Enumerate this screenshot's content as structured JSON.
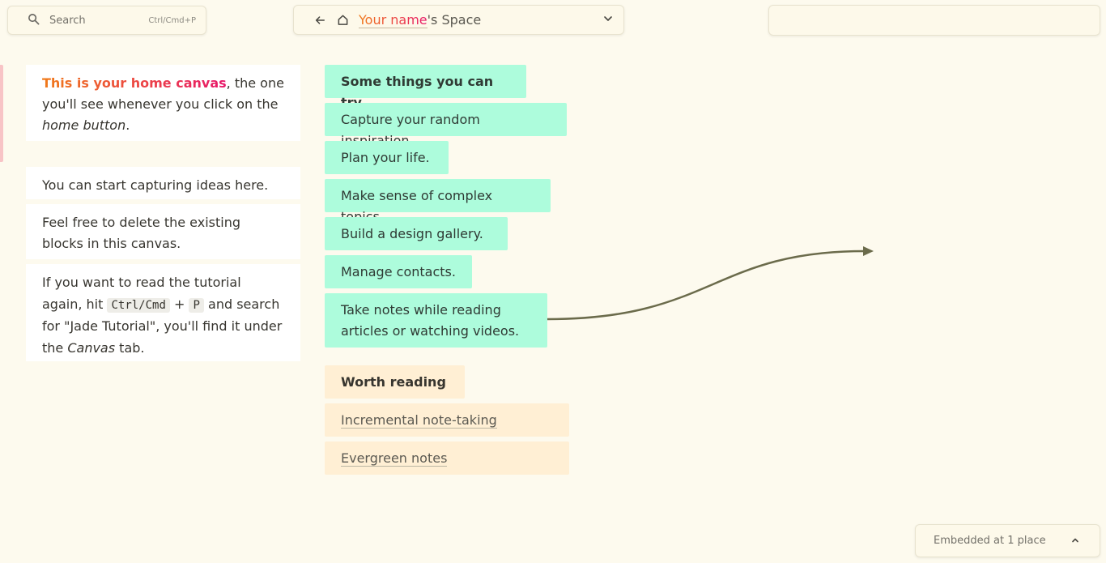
{
  "topbar": {
    "search": {
      "label": "Search",
      "shortcut": "Ctrl/Cmd+P"
    },
    "nav": {
      "title_highlight": "Your name",
      "title_rest": "'s Space"
    }
  },
  "left_cards": {
    "intro": {
      "highlight": "This is your home canvas",
      "text1": ", the one you'll see whenever you click on the ",
      "emph": "home button",
      "text2": "."
    },
    "capture": "You can start capturing ideas here.",
    "delete": "Feel free to delete the existing blocks in this canvas.",
    "tutorial": {
      "t1": "If you want to read the tutorial again, hit ",
      "key1": "Ctrl/Cmd",
      "plus": " + ",
      "key2": "P",
      "t2": " and search for \"Jade Tutorial\", you'll find it under the ",
      "emph": "Canvas",
      "t3": " tab."
    }
  },
  "try_blocks": {
    "heading": "Some things you can try",
    "items": [
      "Capture your random inspiration.",
      "Plan your life.",
      "Make sense of complex topics.",
      "Build a design gallery.",
      "Manage contacts.",
      "Take notes while reading articles or watching videos."
    ]
  },
  "reading_blocks": {
    "heading": "Worth reading",
    "links": [
      "Incremental note-taking",
      "Evergreen notes"
    ]
  },
  "embedded": {
    "label": "Embedded at 1 place"
  },
  "colors": {
    "background": "#fdfaee",
    "green_block": "#adfcdc",
    "orange_block": "#ffefd4",
    "arrow": "#6b6b4b",
    "accent_start": "#f07b1a",
    "accent_end": "#e8176a"
  },
  "icons": {
    "search": "search-icon",
    "back": "arrow-left-icon",
    "home": "home-icon",
    "dropdown": "chevron-down-icon",
    "collapse": "chevron-up-icon"
  }
}
